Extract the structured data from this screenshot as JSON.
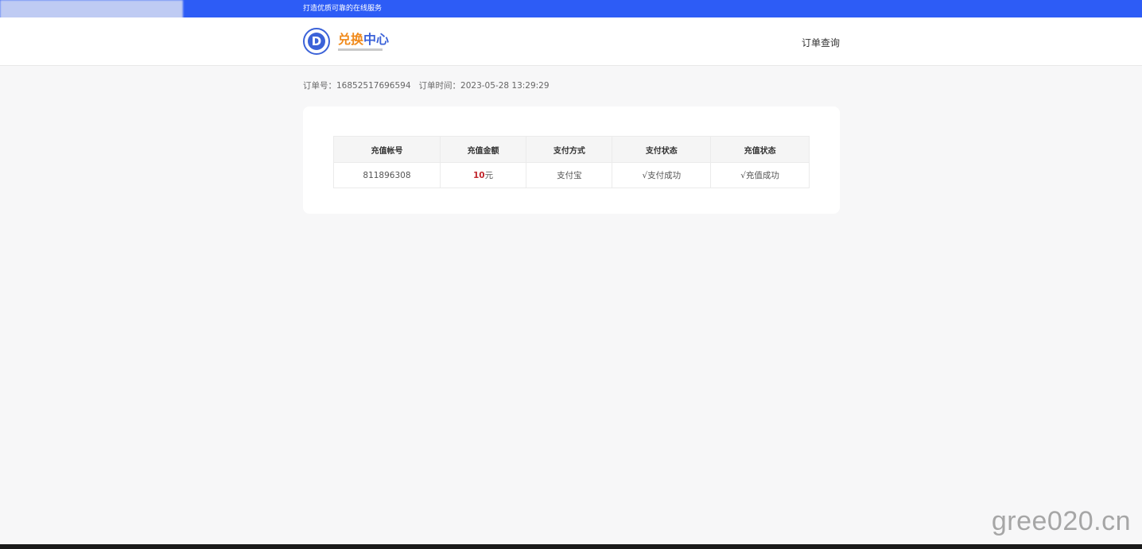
{
  "topbar": {
    "slogan": "打造优质可靠的在线服务"
  },
  "header": {
    "logo_letter": "D",
    "logo_text_part1": "兑换",
    "logo_text_part2": "中心",
    "nav_order_query": "订单查询"
  },
  "order": {
    "number_label": "订单号：",
    "number": "16852517696594",
    "time_label": "订单时间：",
    "time": "2023-05-28 13:29:29"
  },
  "table": {
    "headers": [
      "充值帐号",
      "充值金额",
      "支付方式",
      "支付状态",
      "充值状态"
    ],
    "row": {
      "account": "811896308",
      "amount_number": "10",
      "amount_unit": "元",
      "payment_method": "支付宝",
      "payment_status": "√支付成功",
      "recharge_status": "√充值成功"
    }
  },
  "watermark": "gree020.cn",
  "colors": {
    "topbar": "#2d5cf6",
    "logo_blue": "#3b62d8",
    "logo_orange": "#f08a1c",
    "amount_red": "#c1272d",
    "success_green": "#3ea63e"
  }
}
